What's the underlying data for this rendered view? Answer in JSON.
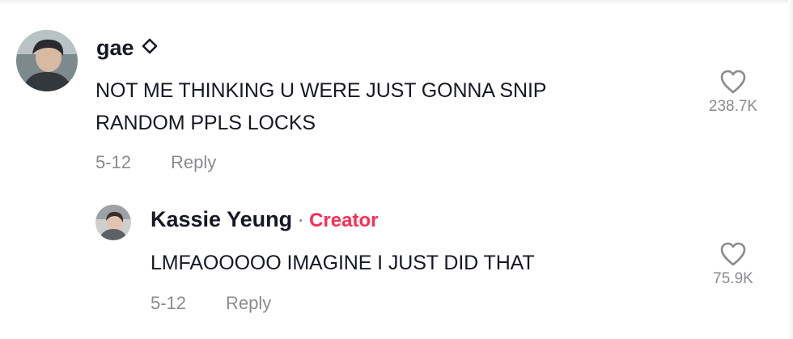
{
  "comments": [
    {
      "username": "gae",
      "username_icon": "diamond-outline-icon",
      "text_lines": [
        "NOT ME THINKING U WERE JUST GONNA SNIP",
        "RANDOM PPLS LOCKS"
      ],
      "date": "5-12",
      "reply_label": "Reply",
      "like_icon": "heart-outline-icon",
      "likes": "238.7K"
    }
  ],
  "replies": [
    {
      "username": "Kassie Yeung",
      "separator": "·",
      "badge": "Creator",
      "text": "LMFAOOOOO IMAGINE I JUST DID THAT",
      "date": "5-12",
      "reply_label": "Reply",
      "like_icon": "heart-outline-icon",
      "likes": "75.9K"
    }
  ],
  "colors": {
    "text": "#161823",
    "secondary": "#8a8b91",
    "creator_badge": "#fe2c55"
  }
}
